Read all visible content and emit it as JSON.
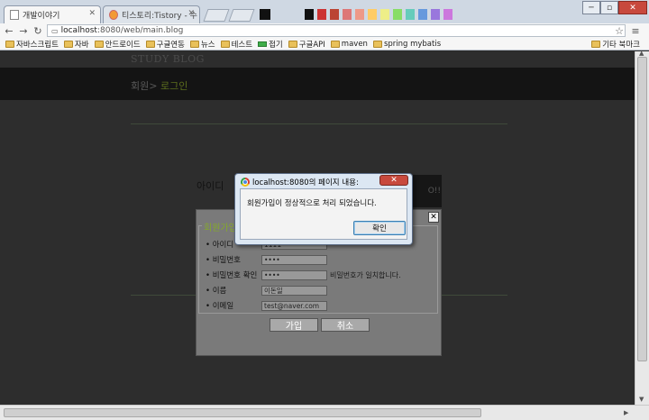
{
  "browser": {
    "tabs": [
      {
        "title": "개발이야기",
        "active": true
      },
      {
        "title": "티스토리:Tistory - 수",
        "active": false
      }
    ],
    "address": {
      "host": "localhost",
      "path": ":8080/web/main.blog"
    },
    "bookmarks": [
      {
        "label": "자바스크립트",
        "icon": "folder-icon"
      },
      {
        "label": "자바",
        "icon": "folder-icon"
      },
      {
        "label": "안드로이드",
        "icon": "folder-icon"
      },
      {
        "label": "구글연동",
        "icon": "folder-icon"
      },
      {
        "label": "뉴스",
        "icon": "folder-icon"
      },
      {
        "label": "테스트",
        "icon": "folder-icon"
      },
      {
        "label": "접기",
        "icon": "bookmark-icon"
      },
      {
        "label": "구글API",
        "icon": "folder-icon"
      },
      {
        "label": "maven",
        "icon": "folder-icon"
      },
      {
        "label": "spring mybatis",
        "icon": "folder-icon"
      }
    ],
    "other_bookmarks": "기타 북마크"
  },
  "page": {
    "blog_title": "STUDY BLOG",
    "crumb_parent": "회원>",
    "crumb_current": " 로그인",
    "login_label": "아이디",
    "strip_text": "O!!"
  },
  "join_form": {
    "close": "✕",
    "legend": "회원가입",
    "rows": [
      {
        "label": "• 아이디",
        "value": "1111",
        "note": ""
      },
      {
        "label": "• 비밀번호",
        "value": "••••",
        "note": ""
      },
      {
        "label": "• 비밀번호 확인",
        "value": "••••",
        "note": "비밀번호가 일치합니다."
      },
      {
        "label": "• 이름",
        "value": "이돈일",
        "note": ""
      },
      {
        "label": "• 이메일",
        "value": "test@naver.com",
        "note": ""
      }
    ],
    "submit": "가입",
    "cancel": "취소"
  },
  "alert": {
    "title": "localhost:8080의 페이지 내용:",
    "close": "✕",
    "message": "회원가입이 정상적으로 처리 되었습니다.",
    "ok": "확인"
  },
  "colors": {
    "accent_green": "#84a82c",
    "crumb_green": "#5d6e1e",
    "alert_frame": "#dce7f3"
  }
}
